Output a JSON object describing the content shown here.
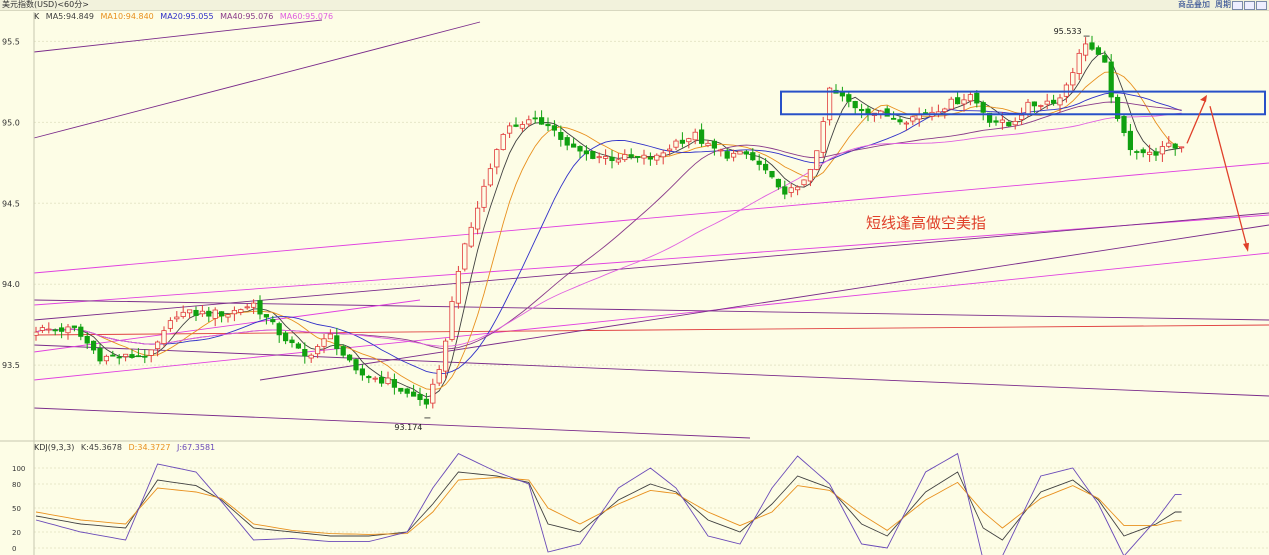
{
  "topbar": {
    "title": "美元指数(USD)<60分>",
    "btn_add": "商品叠加",
    "btn_period": "周期"
  },
  "legend": {
    "prefix": "K",
    "ma5": "MA5:94.849",
    "ma10": "MA10:94.840",
    "ma20": "MA20:95.055",
    "ma40": "MA40:95.076",
    "ma60": "MA60:95.076"
  },
  "kdj": {
    "label": "KDJ(9,3,3)",
    "k": "K:45.3678",
    "d": "D:34.3727",
    "j": "J:67.3581"
  },
  "annotation": "短线逢高做空美指",
  "colors": {
    "background": "#fdfde6",
    "up": "#e03c3c",
    "down": "#10a010",
    "ma5": "#404040",
    "ma10": "#e8901e",
    "ma20": "#3030c8",
    "ma40": "#8a3a8a",
    "ma60": "#e060e0",
    "box": "#2850c8",
    "arrow": "#e0402a"
  },
  "chart_data": [
    {
      "type": "candlestick",
      "name": "price",
      "ylim": [
        93.05,
        95.62
      ],
      "yticks": [
        93.5,
        94.0,
        94.5,
        95.0,
        95.5
      ],
      "ytick_labels": [
        "93.5",
        "94.0",
        "94.5",
        "95.0",
        "95.5"
      ],
      "annotations": [
        {
          "label": "95.533",
          "value": 95.533,
          "kind": "high"
        },
        {
          "label": "93.174",
          "value": 93.174,
          "kind": "low"
        }
      ],
      "grid": true,
      "close_anchors": [
        [
          0,
          93.72
        ],
        [
          6,
          93.72
        ],
        [
          10,
          93.55
        ],
        [
          14,
          93.55
        ],
        [
          18,
          93.57
        ],
        [
          22,
          93.82
        ],
        [
          27,
          93.82
        ],
        [
          30,
          93.82
        ],
        [
          34,
          93.88
        ],
        [
          38,
          93.7
        ],
        [
          42,
          93.55
        ],
        [
          46,
          93.68
        ],
        [
          50,
          93.45
        ],
        [
          55,
          93.4
        ],
        [
          58,
          93.32
        ],
        [
          61,
          93.27
        ],
        [
          63,
          93.45
        ],
        [
          66,
          94.1
        ],
        [
          70,
          94.6
        ],
        [
          73,
          94.95
        ],
        [
          76,
          95.0
        ],
        [
          80,
          95.0
        ],
        [
          83,
          94.85
        ],
        [
          86,
          94.8
        ],
        [
          90,
          94.78
        ],
        [
          94,
          94.78
        ],
        [
          97,
          94.78
        ],
        [
          100,
          94.88
        ],
        [
          103,
          94.92
        ],
        [
          105,
          94.85
        ],
        [
          108,
          94.8
        ],
        [
          111,
          94.8
        ],
        [
          114,
          94.7
        ],
        [
          116,
          94.58
        ],
        [
          119,
          94.58
        ],
        [
          122,
          94.8
        ],
        [
          124,
          95.2
        ],
        [
          128,
          95.1
        ],
        [
          132,
          95.05
        ],
        [
          136,
          95.02
        ],
        [
          140,
          95.07
        ],
        [
          146,
          95.17
        ],
        [
          149,
          95.02
        ],
        [
          152,
          94.98
        ],
        [
          155,
          95.1
        ],
        [
          160,
          95.15
        ],
        [
          164,
          95.5
        ],
        [
          167,
          95.35
        ],
        [
          169,
          95.0
        ],
        [
          171,
          94.85
        ],
        [
          174,
          94.8
        ],
        [
          177,
          94.85
        ]
      ],
      "kdj_series": {
        "K": [
          [
            0,
            40
          ],
          [
            7,
            30
          ],
          [
            14,
            25
          ],
          [
            19,
            85
          ],
          [
            25,
            78
          ],
          [
            29,
            60
          ],
          [
            34,
            25
          ],
          [
            40,
            20
          ],
          [
            46,
            15
          ],
          [
            52,
            15
          ],
          [
            58,
            20
          ],
          [
            62,
            55
          ],
          [
            66,
            95
          ],
          [
            72,
            90
          ],
          [
            77,
            82
          ],
          [
            80,
            30
          ],
          [
            85,
            20
          ],
          [
            91,
            60
          ],
          [
            96,
            80
          ],
          [
            100,
            70
          ],
          [
            105,
            35
          ],
          [
            110,
            20
          ],
          [
            115,
            55
          ],
          [
            119,
            90
          ],
          [
            124,
            75
          ],
          [
            129,
            30
          ],
          [
            133,
            15
          ],
          [
            139,
            70
          ],
          [
            144,
            95
          ],
          [
            148,
            25
          ],
          [
            151,
            10
          ],
          [
            157,
            70
          ],
          [
            162,
            85
          ],
          [
            166,
            60
          ],
          [
            170,
            15
          ],
          [
            175,
            30
          ],
          [
            178,
            45
          ]
        ],
        "D": [
          [
            0,
            45
          ],
          [
            7,
            35
          ],
          [
            14,
            30
          ],
          [
            19,
            75
          ],
          [
            25,
            70
          ],
          [
            29,
            62
          ],
          [
            34,
            30
          ],
          [
            40,
            22
          ],
          [
            46,
            18
          ],
          [
            52,
            17
          ],
          [
            58,
            18
          ],
          [
            62,
            45
          ],
          [
            66,
            85
          ],
          [
            72,
            88
          ],
          [
            77,
            85
          ],
          [
            80,
            50
          ],
          [
            85,
            30
          ],
          [
            91,
            55
          ],
          [
            96,
            72
          ],
          [
            100,
            68
          ],
          [
            105,
            45
          ],
          [
            110,
            28
          ],
          [
            115,
            45
          ],
          [
            119,
            78
          ],
          [
            124,
            72
          ],
          [
            129,
            42
          ],
          [
            133,
            22
          ],
          [
            139,
            60
          ],
          [
            144,
            82
          ],
          [
            148,
            45
          ],
          [
            151,
            25
          ],
          [
            157,
            62
          ],
          [
            162,
            78
          ],
          [
            166,
            62
          ],
          [
            170,
            28
          ],
          [
            175,
            28
          ],
          [
            178,
            34
          ]
        ],
        "J": [
          [
            0,
            35
          ],
          [
            7,
            20
          ],
          [
            14,
            10
          ],
          [
            19,
            105
          ],
          [
            25,
            95
          ],
          [
            29,
            58
          ],
          [
            34,
            10
          ],
          [
            40,
            12
          ],
          [
            46,
            8
          ],
          [
            52,
            8
          ],
          [
            58,
            20
          ],
          [
            62,
            75
          ],
          [
            66,
            118
          ],
          [
            72,
            95
          ],
          [
            77,
            80
          ],
          [
            80,
            -5
          ],
          [
            85,
            5
          ],
          [
            91,
            75
          ],
          [
            96,
            100
          ],
          [
            100,
            75
          ],
          [
            105,
            15
          ],
          [
            110,
            5
          ],
          [
            115,
            75
          ],
          [
            119,
            115
          ],
          [
            124,
            80
          ],
          [
            129,
            5
          ],
          [
            133,
            0
          ],
          [
            139,
            95
          ],
          [
            144,
            118
          ],
          [
            148,
            -15
          ],
          [
            151,
            -10
          ],
          [
            157,
            90
          ],
          [
            162,
            100
          ],
          [
            166,
            55
          ],
          [
            170,
            -10
          ],
          [
            175,
            35
          ],
          [
            178,
            67
          ]
        ]
      },
      "kdj_ylim": [
        0,
        120
      ],
      "kdj_yticks": [
        0,
        20,
        50,
        80,
        100
      ],
      "kdj_ytick_labels": [
        "0",
        "20",
        "50",
        "80",
        "100"
      ],
      "kdj_k_color": "#404040",
      "kdj_d_color": "#e8901e",
      "kdj_j_color": "#6a4ab8"
    }
  ]
}
